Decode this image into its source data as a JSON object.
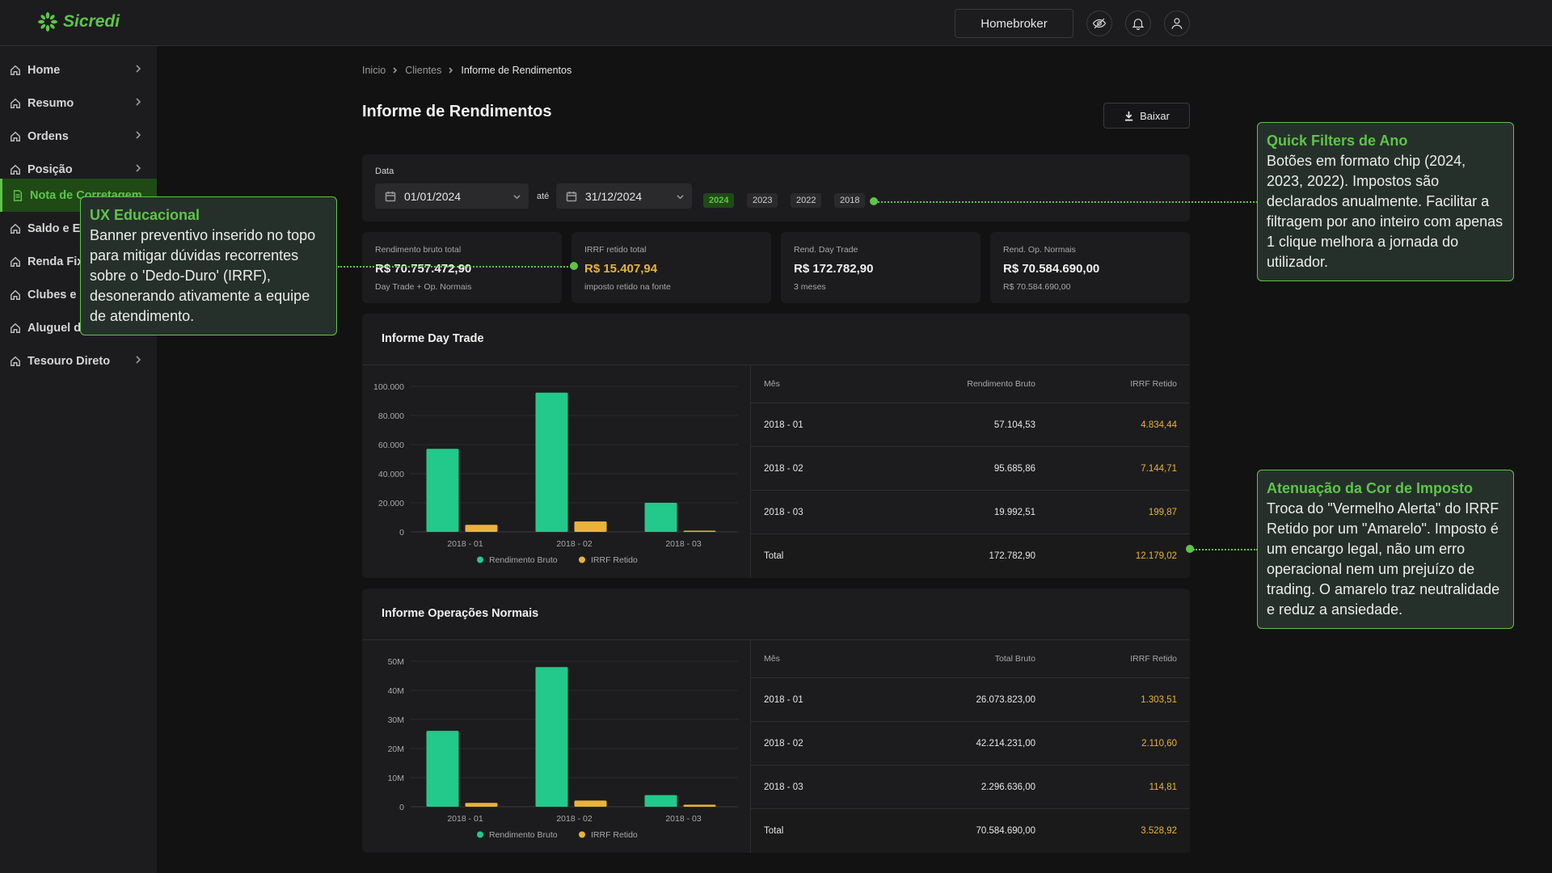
{
  "brand": {
    "name": "Sicredi"
  },
  "header": {
    "homebroker_label": "Homebroker",
    "icons": [
      "eye-off-icon",
      "bell-icon",
      "user-icon"
    ]
  },
  "sidebar": {
    "items": [
      {
        "label": "Home",
        "icon": "home-icon",
        "has_chevron": true
      },
      {
        "label": "Resumo",
        "icon": "home-icon",
        "has_chevron": true
      },
      {
        "label": "Ordens",
        "icon": "home-icon",
        "has_chevron": true
      },
      {
        "label": "Posição",
        "icon": "home-icon",
        "has_chevron": true
      },
      {
        "label": "Nota de Corretagem",
        "icon": "document-icon",
        "active": true
      },
      {
        "label": "Saldo e E",
        "icon": "home-icon"
      },
      {
        "label": "Renda Fix",
        "icon": "home-icon"
      },
      {
        "label": "Clubes e",
        "icon": "home-icon"
      },
      {
        "label": "Aluguel d",
        "icon": "home-icon"
      },
      {
        "label": "Tesouro Direto",
        "icon": "home-icon",
        "has_chevron": true
      }
    ]
  },
  "breadcrumb": [
    "Inicio",
    "Clientes",
    "Informe de Rendimentos"
  ],
  "page": {
    "title": "Informe de Rendimentos",
    "download_label": "Baixar"
  },
  "filters": {
    "label": "Data",
    "start_date": "01/01/2024",
    "separator": "até",
    "end_date": "31/12/2024",
    "year_chips": [
      "2024",
      "2023",
      "2022",
      "2018"
    ],
    "active_chip": "2024"
  },
  "kpis": [
    {
      "label": "Rendimento bruto total",
      "value": "R$ 70.757.472,90",
      "sub": "Day Trade + Op. Normais"
    },
    {
      "label": "IRRF retido total",
      "value": "R$ 15.407,94",
      "sub": "imposto retido na fonte",
      "accent": "#e7b33a"
    },
    {
      "label": "Rend. Day Trade",
      "value": "R$ 172.782,90",
      "sub": "3 meses"
    },
    {
      "label": "Rend. Op. Normais",
      "value": "R$ 70.584.690,00",
      "sub": "R$ 70.584.690,00"
    }
  ],
  "day_trade": {
    "title": "Informe Day Trade",
    "table": {
      "headers": [
        "Mês",
        "Rendimento Bruto",
        "IRRF Retido"
      ],
      "rows": [
        [
          "2018 - 01",
          "57.104,53",
          "4.834,44"
        ],
        [
          "2018 - 02",
          "95.685,86",
          "7.144,71"
        ],
        [
          "2018 - 03",
          "19.992,51",
          "199,87"
        ]
      ],
      "total": [
        "Total",
        "172.782,90",
        "12.179,02"
      ]
    }
  },
  "normais": {
    "title": "Informe Operações Normais",
    "table": {
      "headers": [
        "Mês",
        "Total Bruto",
        "IRRF Retido"
      ],
      "rows": [
        [
          "2018 - 01",
          "26.073.823,00",
          "1.303,51"
        ],
        [
          "2018 - 02",
          "42.214.231,00",
          "2.110,60"
        ],
        [
          "2018 - 03",
          "2.296.636,00",
          "114,81"
        ]
      ],
      "total": [
        "Total",
        "70.584.690,00",
        "3.528,92"
      ]
    }
  },
  "chart_data": [
    {
      "type": "bar",
      "categories": [
        "2018 - 01",
        "2018 - 02",
        "2018 - 03"
      ],
      "series": [
        {
          "name": "Rendimento Bruto",
          "values": [
            57104.53,
            95685.86,
            19992.51
          ],
          "color": "#22c98a"
        },
        {
          "name": "IRRF Retido",
          "values": [
            4834.44,
            7144.71,
            199.87
          ],
          "color": "#e7b33a"
        }
      ],
      "yticks": [
        "0",
        "20.000",
        "40.000",
        "60.000",
        "80.000",
        "100.000"
      ],
      "ylim": [
        0,
        100000
      ],
      "legend": "bottom",
      "grid": true
    },
    {
      "type": "bar",
      "categories": [
        "2018 - 01",
        "2018 - 02",
        "2018 - 03"
      ],
      "series": [
        {
          "name": "Rendimento Bruto",
          "values": [
            26073823,
            48000000,
            4000000
          ],
          "color": "#22c98a"
        },
        {
          "name": "IRRF Retido",
          "values": [
            1303510,
            2110600,
            700000
          ],
          "color": "#e7b33a"
        }
      ],
      "yticks": [
        "0",
        "10M",
        "20M",
        "30M",
        "40M",
        "50M"
      ],
      "ylim": [
        0,
        50000000
      ],
      "legend": "bottom",
      "grid": true
    }
  ],
  "annotations": {
    "ux": {
      "title": "UX Educacional",
      "body": "Banner preventivo inserido no topo para mitigar dúvidas recorrentes sobre o 'Dedo-Duro' (IRRF), desonerando ativamente a equipe de atendimento."
    },
    "quick": {
      "title": "Quick Filters de Ano",
      "body": "Botões em formato chip (2024, 2023, 2022). Impostos são declarados anualmente. Facilitar a filtragem por ano inteiro com apenas 1 clique melhora a jornada do utilizador."
    },
    "cor": {
      "title": "Atenuação da Cor de Imposto",
      "body": "Troca do \"Vermelho Alerta\" do IRRF Retido por um \"Amarelo\". Imposto é um encargo legal, não um erro operacional nem um prejuízo de trading. O amarelo traz neutralidade e reduz a ansiedade."
    }
  },
  "colors": {
    "accent": "#5ec44a",
    "bar_green": "#22c98a",
    "tax_amber": "#e7b33a",
    "background": "#121212",
    "panel": "#1c1c1e"
  }
}
